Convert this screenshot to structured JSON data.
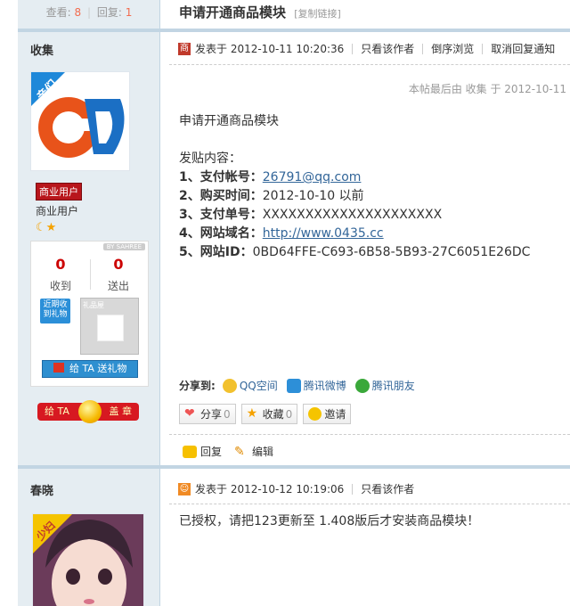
{
  "thread": {
    "views_label": "查看:",
    "views": "8",
    "stat_sep": "|",
    "replies_label": "回复:",
    "replies": "1",
    "title": "申请开通商品模块",
    "copy_link": "[复制链接]"
  },
  "post1": {
    "author": "收集",
    "avatar_text": "亲们",
    "user_badge": "商业用户",
    "user_group": "商业用户",
    "stars": "☾★",
    "posted_at": "发表于 2012-10-11 10:20:36",
    "only_author": "只看该作者",
    "reverse_view": "倒序浏览",
    "cancel_notify": "取消回复通知",
    "last_edit": "本帖最后由 收集 于 2012-10-11",
    "gifts": {
      "by": "BY SAHREE",
      "received_count": "0",
      "received_label": "收到",
      "sent_count": "0",
      "sent_label": "送出",
      "recent_label": "近期收到礼物",
      "shop_label": "礼品屋",
      "give_button": "给 TA 送礼物"
    },
    "stamp": {
      "left": "给 TA",
      "right": "盖 章"
    },
    "content": {
      "title_line": "申请开通商品模块",
      "intro": "发贴内容：",
      "items": [
        {
          "label": "1、支付帐号：",
          "value": "26791@qq.com",
          "link": true
        },
        {
          "label": "2、购买时间：",
          "value": "2012-10-10 以前",
          "link": false
        },
        {
          "label": "3、支付单号：",
          "value": "XXXXXXXXXXXXXXXXXXXXX",
          "link": false
        },
        {
          "label": "4、网站域名：",
          "value": "http://www.0435.cc",
          "link": true
        },
        {
          "label": "5、网站ID：",
          "value": "0BD64FFE-C693-6B58-5B93-27C6051E26DC",
          "link": false
        }
      ]
    },
    "share": {
      "label": "分享到:",
      "qzone": "QQ空间",
      "weibo": "腾讯微博",
      "friends": "腾讯朋友"
    },
    "buttons": {
      "share": "分享",
      "share_count": "0",
      "favorite": "收藏",
      "favorite_count": "0",
      "invite": "邀请"
    },
    "actions": {
      "reply": "回复",
      "edit": "编辑"
    }
  },
  "post2": {
    "author": "春晓",
    "avatar_text": "少妇",
    "posted_at": "发表于 2012-10-12 10:19:06",
    "only_author": "只看该作者",
    "content": "已授权，请把123更新至 1.408版后才安装商品模块！"
  }
}
